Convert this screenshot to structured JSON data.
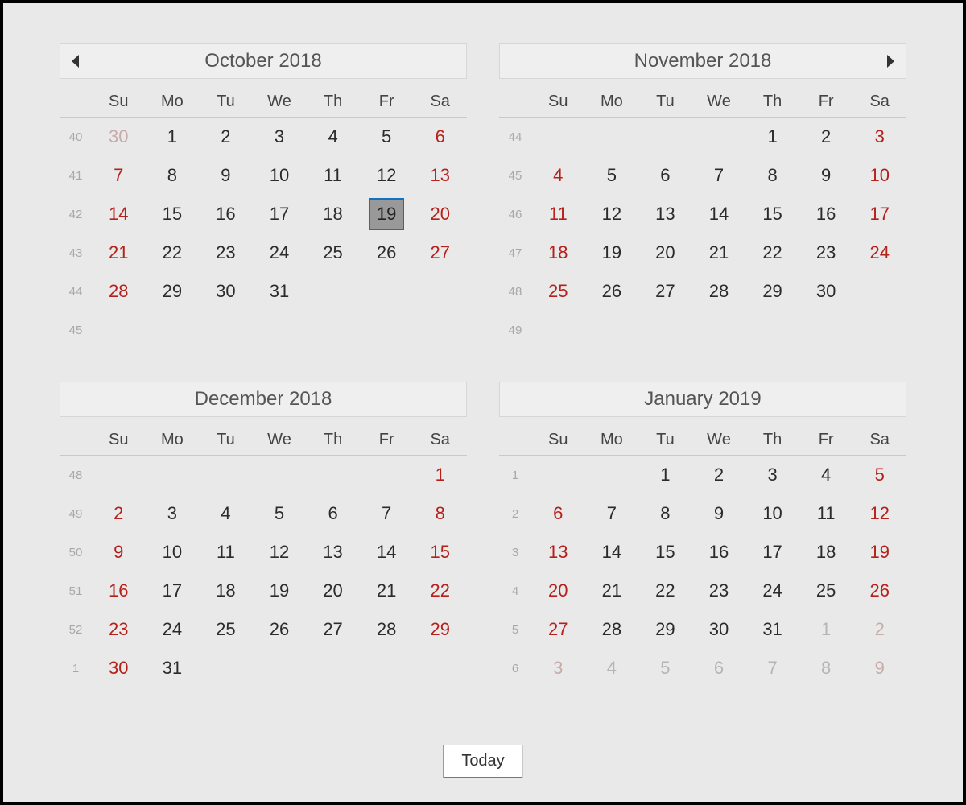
{
  "today_label": "Today",
  "dow": [
    "Su",
    "Mo",
    "Tu",
    "We",
    "Th",
    "Fr",
    "Sa"
  ],
  "months": [
    {
      "title": "October 2018",
      "nav_prev": true,
      "nav_next": false,
      "weeks": [
        {
          "wk": "40",
          "days": [
            {
              "n": "30",
              "cls": "other"
            },
            {
              "n": "1"
            },
            {
              "n": "2"
            },
            {
              "n": "3"
            },
            {
              "n": "4"
            },
            {
              "n": "5"
            },
            {
              "n": "6",
              "cls": "red"
            }
          ]
        },
        {
          "wk": "41",
          "days": [
            {
              "n": "7",
              "cls": "red"
            },
            {
              "n": "8"
            },
            {
              "n": "9"
            },
            {
              "n": "10"
            },
            {
              "n": "11"
            },
            {
              "n": "12"
            },
            {
              "n": "13",
              "cls": "red"
            }
          ]
        },
        {
          "wk": "42",
          "days": [
            {
              "n": "14",
              "cls": "red"
            },
            {
              "n": "15"
            },
            {
              "n": "16"
            },
            {
              "n": "17"
            },
            {
              "n": "18"
            },
            {
              "n": "19",
              "cls": "selected"
            },
            {
              "n": "20",
              "cls": "red"
            }
          ]
        },
        {
          "wk": "43",
          "days": [
            {
              "n": "21",
              "cls": "red"
            },
            {
              "n": "22"
            },
            {
              "n": "23"
            },
            {
              "n": "24"
            },
            {
              "n": "25"
            },
            {
              "n": "26"
            },
            {
              "n": "27",
              "cls": "red"
            }
          ]
        },
        {
          "wk": "44",
          "days": [
            {
              "n": "28",
              "cls": "red"
            },
            {
              "n": "29"
            },
            {
              "n": "30"
            },
            {
              "n": "31"
            },
            {
              "n": ""
            },
            {
              "n": ""
            },
            {
              "n": ""
            }
          ]
        },
        {
          "wk": "45",
          "days": [
            {
              "n": ""
            },
            {
              "n": ""
            },
            {
              "n": ""
            },
            {
              "n": ""
            },
            {
              "n": ""
            },
            {
              "n": ""
            },
            {
              "n": ""
            }
          ]
        }
      ]
    },
    {
      "title": "November 2018",
      "nav_prev": false,
      "nav_next": true,
      "weeks": [
        {
          "wk": "44",
          "days": [
            {
              "n": ""
            },
            {
              "n": ""
            },
            {
              "n": ""
            },
            {
              "n": ""
            },
            {
              "n": "1"
            },
            {
              "n": "2"
            },
            {
              "n": "3",
              "cls": "red"
            }
          ]
        },
        {
          "wk": "45",
          "days": [
            {
              "n": "4",
              "cls": "red"
            },
            {
              "n": "5"
            },
            {
              "n": "6"
            },
            {
              "n": "7"
            },
            {
              "n": "8"
            },
            {
              "n": "9"
            },
            {
              "n": "10",
              "cls": "red"
            }
          ]
        },
        {
          "wk": "46",
          "days": [
            {
              "n": "11",
              "cls": "red"
            },
            {
              "n": "12"
            },
            {
              "n": "13"
            },
            {
              "n": "14"
            },
            {
              "n": "15"
            },
            {
              "n": "16"
            },
            {
              "n": "17",
              "cls": "red"
            }
          ]
        },
        {
          "wk": "47",
          "days": [
            {
              "n": "18",
              "cls": "red"
            },
            {
              "n": "19"
            },
            {
              "n": "20"
            },
            {
              "n": "21"
            },
            {
              "n": "22"
            },
            {
              "n": "23"
            },
            {
              "n": "24",
              "cls": "red"
            }
          ]
        },
        {
          "wk": "48",
          "days": [
            {
              "n": "25",
              "cls": "red"
            },
            {
              "n": "26"
            },
            {
              "n": "27"
            },
            {
              "n": "28"
            },
            {
              "n": "29"
            },
            {
              "n": "30"
            },
            {
              "n": ""
            }
          ]
        },
        {
          "wk": "49",
          "days": [
            {
              "n": ""
            },
            {
              "n": ""
            },
            {
              "n": ""
            },
            {
              "n": ""
            },
            {
              "n": ""
            },
            {
              "n": ""
            },
            {
              "n": ""
            }
          ]
        }
      ]
    },
    {
      "title": "December 2018",
      "nav_prev": false,
      "nav_next": false,
      "weeks": [
        {
          "wk": "48",
          "days": [
            {
              "n": ""
            },
            {
              "n": ""
            },
            {
              "n": ""
            },
            {
              "n": ""
            },
            {
              "n": ""
            },
            {
              "n": ""
            },
            {
              "n": "1",
              "cls": "red"
            }
          ]
        },
        {
          "wk": "49",
          "days": [
            {
              "n": "2",
              "cls": "red"
            },
            {
              "n": "3"
            },
            {
              "n": "4"
            },
            {
              "n": "5"
            },
            {
              "n": "6"
            },
            {
              "n": "7"
            },
            {
              "n": "8",
              "cls": "red"
            }
          ]
        },
        {
          "wk": "50",
          "days": [
            {
              "n": "9",
              "cls": "red"
            },
            {
              "n": "10"
            },
            {
              "n": "11"
            },
            {
              "n": "12"
            },
            {
              "n": "13"
            },
            {
              "n": "14"
            },
            {
              "n": "15",
              "cls": "red"
            }
          ]
        },
        {
          "wk": "51",
          "days": [
            {
              "n": "16",
              "cls": "red"
            },
            {
              "n": "17"
            },
            {
              "n": "18"
            },
            {
              "n": "19"
            },
            {
              "n": "20"
            },
            {
              "n": "21"
            },
            {
              "n": "22",
              "cls": "red"
            }
          ]
        },
        {
          "wk": "52",
          "days": [
            {
              "n": "23",
              "cls": "red"
            },
            {
              "n": "24"
            },
            {
              "n": "25"
            },
            {
              "n": "26"
            },
            {
              "n": "27"
            },
            {
              "n": "28"
            },
            {
              "n": "29",
              "cls": "red"
            }
          ]
        },
        {
          "wk": "1",
          "days": [
            {
              "n": "30",
              "cls": "red"
            },
            {
              "n": "31"
            },
            {
              "n": ""
            },
            {
              "n": ""
            },
            {
              "n": ""
            },
            {
              "n": ""
            },
            {
              "n": ""
            }
          ]
        }
      ]
    },
    {
      "title": "January 2019",
      "nav_prev": false,
      "nav_next": false,
      "weeks": [
        {
          "wk": "1",
          "days": [
            {
              "n": ""
            },
            {
              "n": ""
            },
            {
              "n": "1"
            },
            {
              "n": "2"
            },
            {
              "n": "3"
            },
            {
              "n": "4"
            },
            {
              "n": "5",
              "cls": "red"
            }
          ]
        },
        {
          "wk": "2",
          "days": [
            {
              "n": "6",
              "cls": "red"
            },
            {
              "n": "7"
            },
            {
              "n": "8"
            },
            {
              "n": "9"
            },
            {
              "n": "10"
            },
            {
              "n": "11"
            },
            {
              "n": "12",
              "cls": "red"
            }
          ]
        },
        {
          "wk": "3",
          "days": [
            {
              "n": "13",
              "cls": "red"
            },
            {
              "n": "14"
            },
            {
              "n": "15"
            },
            {
              "n": "16"
            },
            {
              "n": "17"
            },
            {
              "n": "18"
            },
            {
              "n": "19",
              "cls": "red"
            }
          ]
        },
        {
          "wk": "4",
          "days": [
            {
              "n": "20",
              "cls": "red"
            },
            {
              "n": "21"
            },
            {
              "n": "22"
            },
            {
              "n": "23"
            },
            {
              "n": "24"
            },
            {
              "n": "25"
            },
            {
              "n": "26",
              "cls": "red"
            }
          ]
        },
        {
          "wk": "5",
          "days": [
            {
              "n": "27",
              "cls": "red"
            },
            {
              "n": "28"
            },
            {
              "n": "29"
            },
            {
              "n": "30"
            },
            {
              "n": "31"
            },
            {
              "n": "1",
              "cls": "otherg"
            },
            {
              "n": "2",
              "cls": "other"
            }
          ]
        },
        {
          "wk": "6",
          "days": [
            {
              "n": "3",
              "cls": "other"
            },
            {
              "n": "4",
              "cls": "otherg"
            },
            {
              "n": "5",
              "cls": "otherg"
            },
            {
              "n": "6",
              "cls": "otherg"
            },
            {
              "n": "7",
              "cls": "otherg"
            },
            {
              "n": "8",
              "cls": "otherg"
            },
            {
              "n": "9",
              "cls": "other"
            }
          ]
        }
      ]
    }
  ]
}
